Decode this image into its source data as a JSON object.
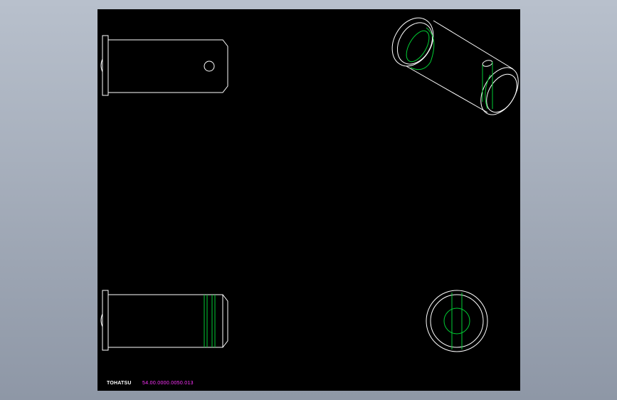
{
  "title_block": {
    "logo_text": "TOHATSU",
    "drawing_number": "54.00.0000.0050.013"
  },
  "colors": {
    "background": "#9aa3b2",
    "model_space": "#000000",
    "outline": "#ffffff",
    "hidden_lines": "#00cc33",
    "annotation": "#ff33ff"
  },
  "views": [
    "front-view",
    "isometric-view",
    "bottom-view",
    "end-view"
  ]
}
